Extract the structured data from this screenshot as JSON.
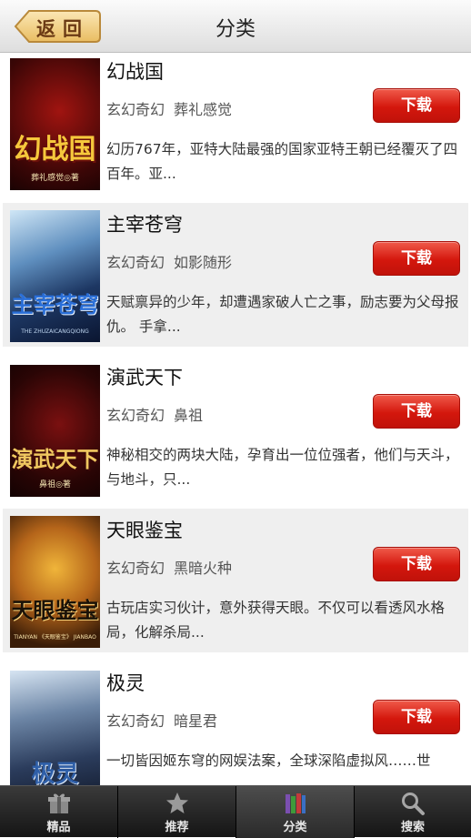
{
  "header": {
    "back_label": "返回",
    "title": "分类"
  },
  "books": [
    {
      "title": "幻战国",
      "category": "玄幻奇幻",
      "author": "葬礼感觉",
      "description": "幻历767年，亚特大陆最强的国家亚特王朝已经覆灭了四百年。亚...",
      "download_label": "下载",
      "cover_text": "幻战国",
      "cover_author": "葬礼感觉◎著"
    },
    {
      "title": "主宰苍穹",
      "category": "玄幻奇幻",
      "author": "如影随形",
      "description": "天赋禀异的少年，却遭遇家破人亡之事，励志要为父母报仇。 手拿...",
      "download_label": "下载",
      "cover_text": "主宰苍穹",
      "cover_author": "THE ZHUZAICANGQIONG"
    },
    {
      "title": "演武天下",
      "category": "玄幻奇幻",
      "author": "鼻祖",
      "description": "神秘相交的两块大陆，孕育出一位位强者，他们与天斗，与地斗，只...",
      "download_label": "下载",
      "cover_text": "演武天下",
      "cover_author": "鼻祖◎著"
    },
    {
      "title": "天眼鉴宝",
      "category": "玄幻奇幻",
      "author": "黑暗火种",
      "description": "古玩店实习伙计，意外获得天眼。不仅可以看透风水格局，化解杀局...",
      "download_label": "下载",
      "cover_text": "天眼鉴宝",
      "cover_author": "TIANYAN 《天眼鉴宝》 JIANBAO"
    },
    {
      "title": "极灵",
      "category": "玄幻奇幻",
      "author": "暗星君",
      "description": "一切皆因姬东穹的网娱法案，全球深陷虚拟风……世",
      "download_label": "下载",
      "cover_text": "极灵",
      "cover_author": ""
    }
  ],
  "tabs": [
    {
      "label": "精品",
      "icon": "gift-icon"
    },
    {
      "label": "推荐",
      "icon": "star-icon"
    },
    {
      "label": "分类",
      "icon": "books-icon"
    },
    {
      "label": "搜索",
      "icon": "search-icon"
    }
  ],
  "colors": {
    "download": "#d4170d",
    "tab_bar": "#1f1f1f",
    "back_button": "#f3d28a"
  }
}
